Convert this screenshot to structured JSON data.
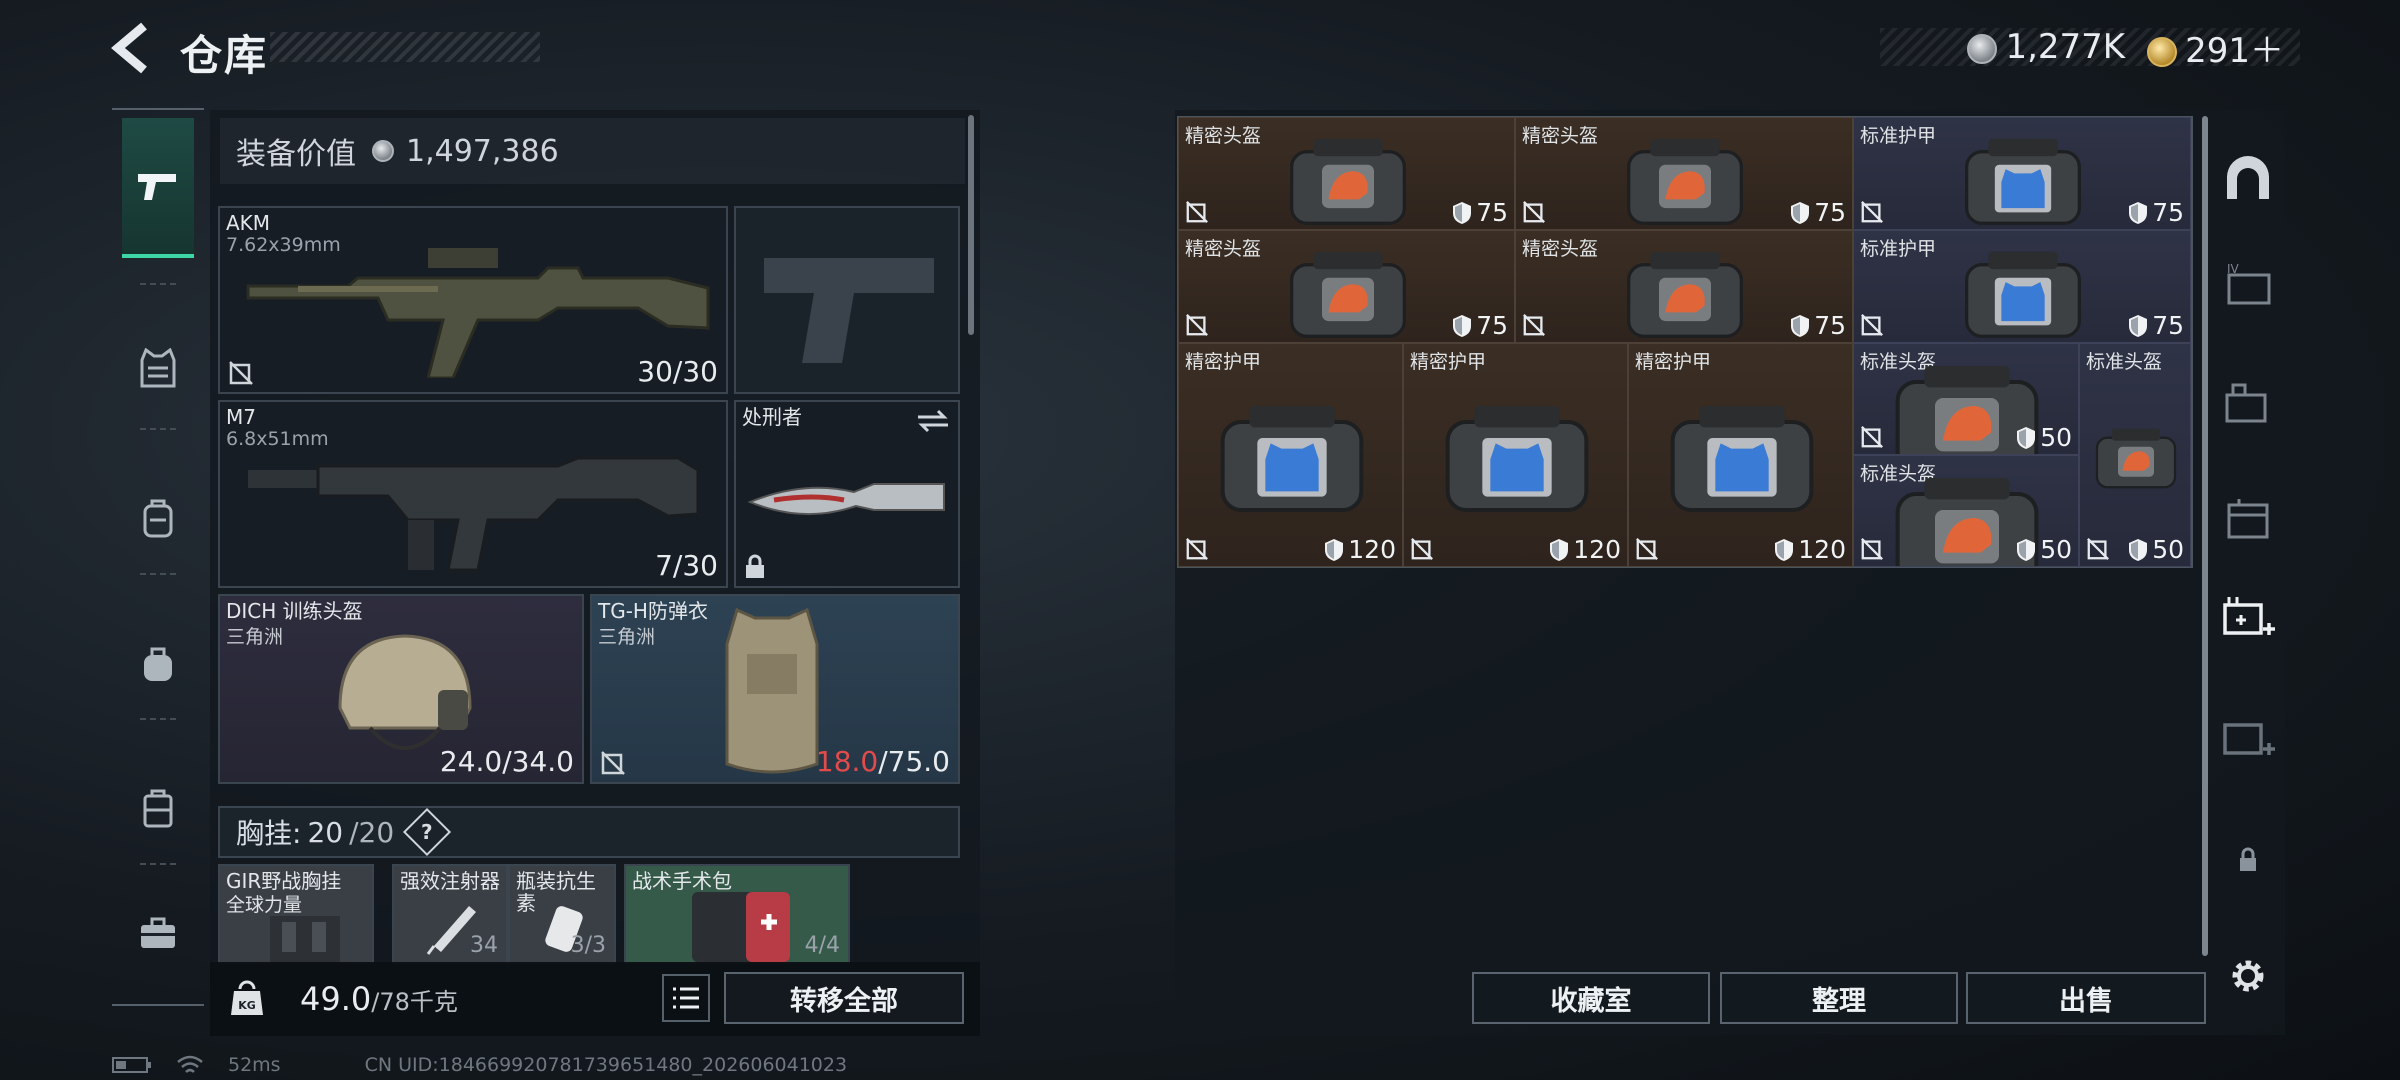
{
  "header": {
    "title": "仓库",
    "currency_silver": "1,277K",
    "currency_gold": "291＋"
  },
  "equipment": {
    "value_label": "装备价值",
    "value": "1,497,386",
    "primary": {
      "name": "AKM",
      "caliber": "7.62x39mm",
      "ammo": "30/30"
    },
    "secondary": {
      "name": "M7",
      "caliber": "6.8x51mm",
      "ammo": "7/30"
    },
    "melee": {
      "name": "处刑者"
    },
    "helmet": {
      "name": "DICH 训练头盔",
      "origin": "三角洲",
      "durability": "24.0/34.0"
    },
    "armor": {
      "name": "TG-H防弹衣",
      "origin": "三角洲",
      "durability_current": "18.0",
      "durability_max": "/75.0"
    },
    "chest_rig": {
      "label": "胸挂:",
      "capacity_used": "20",
      "capacity_total": "/20"
    },
    "rig_items": [
      {
        "name": "GIR野战胸挂",
        "sub": "全球力量"
      },
      {
        "name": "强效注射器",
        "count": "34"
      },
      {
        "name": "瓶装抗生素",
        "count": "3/3"
      },
      {
        "name": "战术手术包",
        "count": "4/4"
      }
    ],
    "weight": "49.0",
    "weight_max": "/78千克",
    "transfer_all": "转移全部"
  },
  "storage": {
    "items": [
      {
        "label": "精密头盔",
        "durability": "75",
        "color": "brown",
        "kind": "helmet"
      },
      {
        "label": "精密头盔",
        "durability": "75",
        "color": "brown",
        "kind": "helmet"
      },
      {
        "label": "标准护甲",
        "durability": "75",
        "color": "blue",
        "kind": "armor"
      },
      {
        "label": "精密头盔",
        "durability": "75",
        "color": "brown",
        "kind": "helmet"
      },
      {
        "label": "精密头盔",
        "durability": "75",
        "color": "brown",
        "kind": "helmet"
      },
      {
        "label": "标准护甲",
        "durability": "75",
        "color": "blue",
        "kind": "armor"
      },
      {
        "label": "精密护甲",
        "durability": "120",
        "color": "brown",
        "kind": "armor"
      },
      {
        "label": "精密护甲",
        "durability": "120",
        "color": "brown",
        "kind": "armor"
      },
      {
        "label": "精密护甲",
        "durability": "120",
        "color": "brown",
        "kind": "armor"
      },
      {
        "label": "标准头盔",
        "durability": "50",
        "color": "blue",
        "kind": "helmet"
      },
      {
        "label": "标准头盔",
        "durability": "50",
        "color": "blue",
        "kind": "helmet"
      },
      {
        "label": "标准头盔",
        "durability": "50",
        "color": "blue",
        "kind": "helmet"
      }
    ],
    "buttons": {
      "collection": "收藏室",
      "organize": "整理",
      "sell": "出售"
    }
  },
  "status_bar": {
    "ping": "52ms",
    "uid": "CN UID:1846699207817396514​80_202606041023"
  },
  "colors": {
    "accent": "#3fd6a5",
    "warn": "#e24b4b"
  }
}
